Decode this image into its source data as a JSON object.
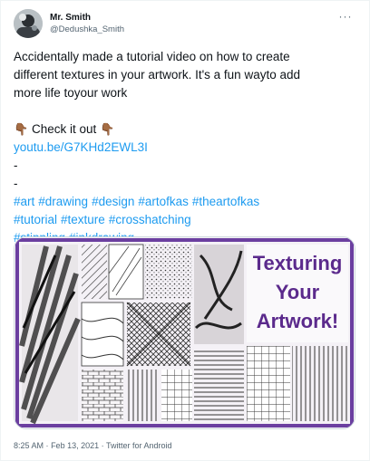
{
  "tweet": {
    "display_name": "Mr. Smith",
    "handle": "@Dedushka_Smith",
    "more_label": "···",
    "text_line1": "Accidentally made a tutorial video on how to create",
    "text_line2": "different textures in your artwork. It's a fun wayto add",
    "text_line3": "more life toyour work",
    "cta_emoji_left": "👇🏾",
    "cta_text": "Check it out",
    "cta_emoji_right": "👇🏾",
    "link": "youtu.be/G7KHd2EWL3I",
    "dash1": "-",
    "dash2": "-",
    "hashtags_line1": [
      "#art",
      "#drawing",
      "#design",
      "#artofkas",
      "#theartofkas"
    ],
    "hashtags_line2": [
      "#tutorial",
      "#texture",
      "#crosshatching"
    ],
    "hashtags_line3": [
      "#stippling",
      "#inkdrawing"
    ],
    "time": "8:25 AM",
    "separator": "·",
    "date": "Feb 13, 2021",
    "source": "Twitter for Android"
  },
  "media": {
    "title_line1": "Texturing",
    "title_line2": "Your",
    "title_line3": "Artwork!",
    "title_color": "#5b2a8c",
    "frame_color": "#6b3fa0"
  },
  "colors": {
    "link": "#1d9bf0",
    "text": "#0f1419",
    "secondary": "#536471"
  }
}
